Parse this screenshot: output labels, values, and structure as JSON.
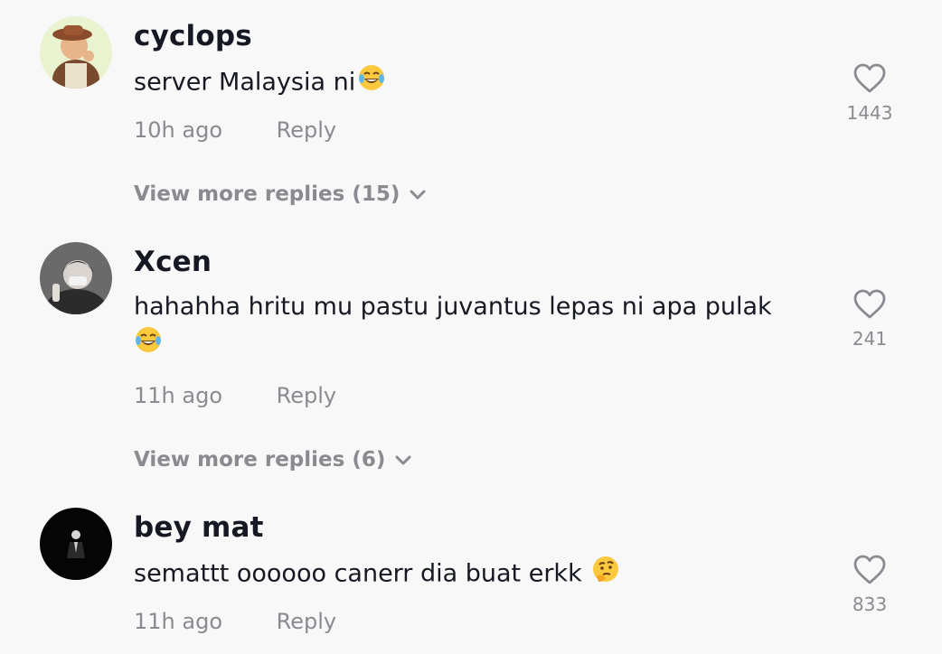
{
  "comments": [
    {
      "username": "cyclops",
      "text": "server Malaysia ni",
      "emoji": "tears-of-joy-emoji",
      "time": "10h ago",
      "reply_label": "Reply",
      "likes": "1443",
      "view_more": "View more replies (15)"
    },
    {
      "username": "Xcen",
      "text": "hahahha hritu mu pastu juvantus lepas ni apa pulak",
      "emoji": "tears-of-joy-emoji",
      "time": "11h ago",
      "reply_label": "Reply",
      "likes": "241",
      "view_more": "View more replies (6)"
    },
    {
      "username": "bey mat",
      "text": "semattt oooooo canerr dia buat erkk",
      "emoji": "thinking-face-emoji",
      "time": "11h ago",
      "reply_label": "Reply",
      "likes": "833"
    }
  ],
  "icons": {
    "like": "heart-outline-icon",
    "expand": "chevron-down-icon"
  },
  "colors": {
    "background": "#f8f8f8",
    "primary_text": "#161823",
    "secondary_text": "#8a8b91"
  }
}
